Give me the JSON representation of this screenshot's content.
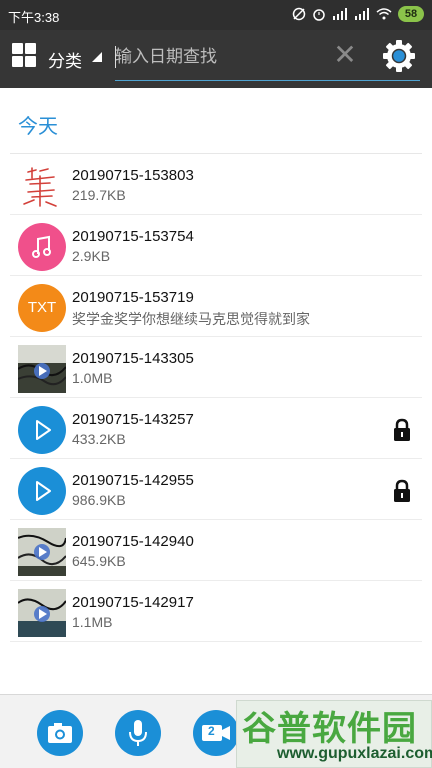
{
  "status": {
    "time": "下午3:38",
    "battery": "58"
  },
  "toolbar": {
    "category_label": "分类",
    "search_placeholder": "输入日期查找"
  },
  "section": {
    "title": "今天"
  },
  "items": [
    {
      "title": "20190715-153803",
      "sub": "219.7KB",
      "type": "handwriting-thumbnail",
      "locked": false
    },
    {
      "title": "20190715-153754",
      "sub": "2.9KB",
      "type": "audio",
      "icon_color": "#f0508b",
      "locked": false
    },
    {
      "title": "20190715-153719",
      "sub": "奖学金奖学你想继续马克思觉得就到家",
      "type": "text",
      "badge": "TXT",
      "icon_color": "#f38a18",
      "locked": false
    },
    {
      "title": "20190715-143305",
      "sub": "1.0MB",
      "type": "video-thumbnail",
      "locked": false
    },
    {
      "title": "20190715-143257",
      "sub": "433.2KB",
      "type": "video",
      "icon_color": "#1b8fd7",
      "locked": true
    },
    {
      "title": "20190715-142955",
      "sub": "986.9KB",
      "type": "video",
      "icon_color": "#1b8fd7",
      "locked": true
    },
    {
      "title": "20190715-142940",
      "sub": "645.9KB",
      "type": "video-thumbnail",
      "locked": false
    },
    {
      "title": "20190715-142917",
      "sub": "1.1MB",
      "type": "video-thumbnail",
      "locked": false
    }
  ],
  "bottom_bar": {
    "video_badge": "2"
  },
  "watermark": {
    "big": "谷普软件园",
    "small": "www.gupuxlazai.com"
  },
  "colors": {
    "accent": "#2a8fd6",
    "fab_blue": "#1b8fd7"
  }
}
